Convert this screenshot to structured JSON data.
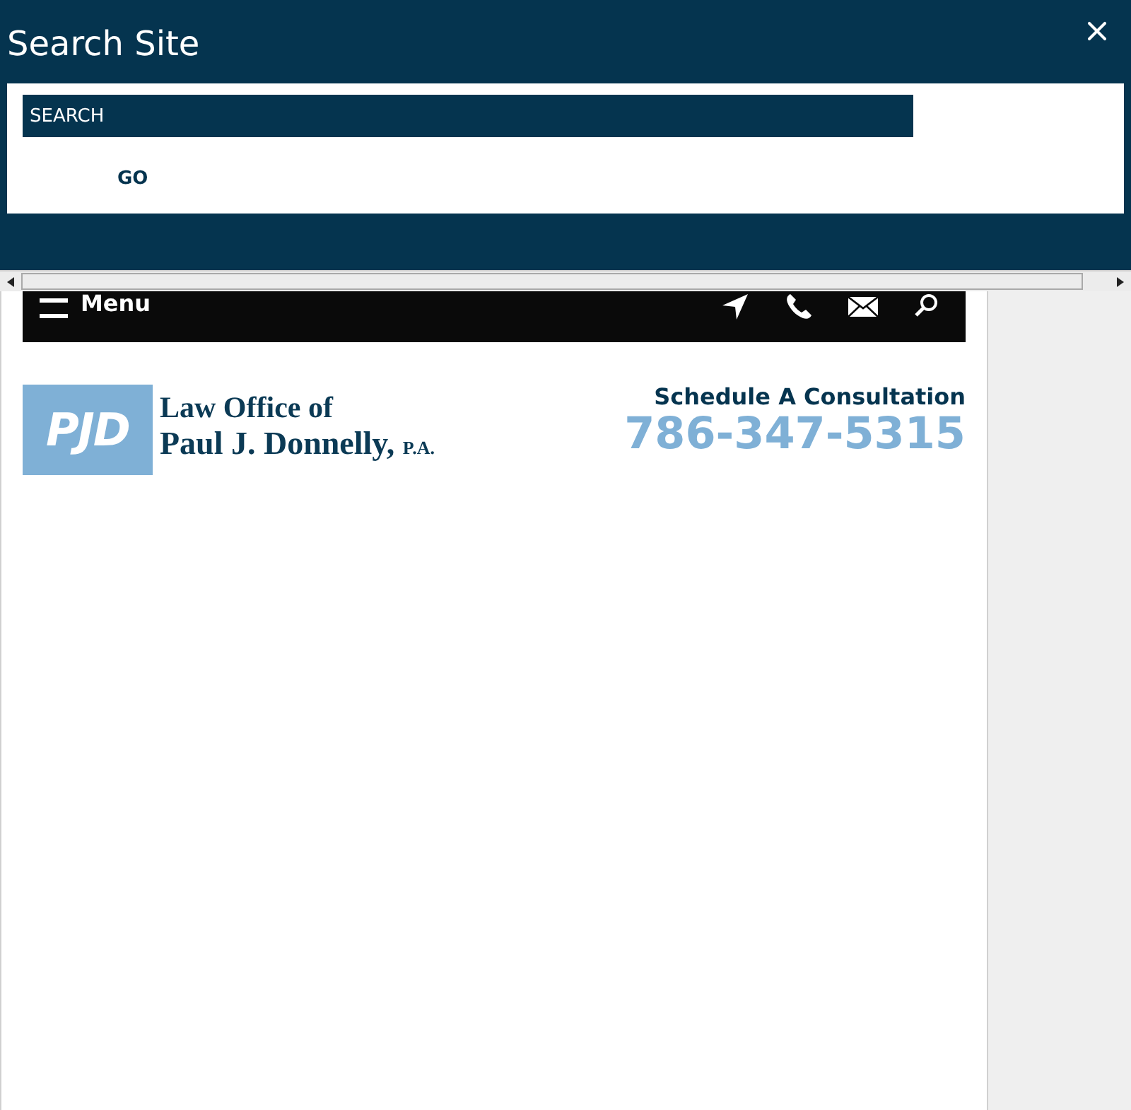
{
  "search_overlay": {
    "title": "Search Site",
    "search_field": {
      "placeholder": "SEARCH"
    },
    "go_button": "GO"
  },
  "nav_bar": {
    "menu_label": "Menu"
  },
  "header": {
    "logo": {
      "monogram": "PJD",
      "line_1": "Law Office of",
      "line_2": "Paul J. Donnelly,",
      "suffix": "P.A."
    },
    "cta": "Schedule A Consultation",
    "phone": "786-347-5315"
  }
}
